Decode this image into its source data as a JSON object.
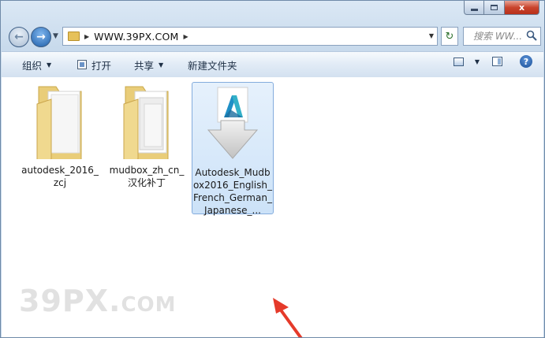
{
  "window": {
    "controls": {
      "minimize": "",
      "maximize": "",
      "close": "x"
    }
  },
  "nav": {
    "address_path": "WWW.39PX.COM",
    "search_placeholder": "搜索 WW..."
  },
  "toolbar": {
    "organize": "组织",
    "open": "打开",
    "share": "共享",
    "new_folder": "新建文件夹"
  },
  "files": [
    {
      "name": "autodesk_2016_zcj",
      "type": "folder"
    },
    {
      "name": "mudbox_zh_cn_汉化补丁",
      "type": "folder"
    },
    {
      "name": "Autodesk_Mudbox2016_English_French_German_Japanese_...",
      "type": "installer",
      "selected": true
    }
  ],
  "watermark": {
    "main": "39PX.",
    "suffix": "COM"
  },
  "colors": {
    "accent": "#3399ff",
    "selection": "#cce2f8",
    "annotation_arrow": "#e53a2a"
  }
}
